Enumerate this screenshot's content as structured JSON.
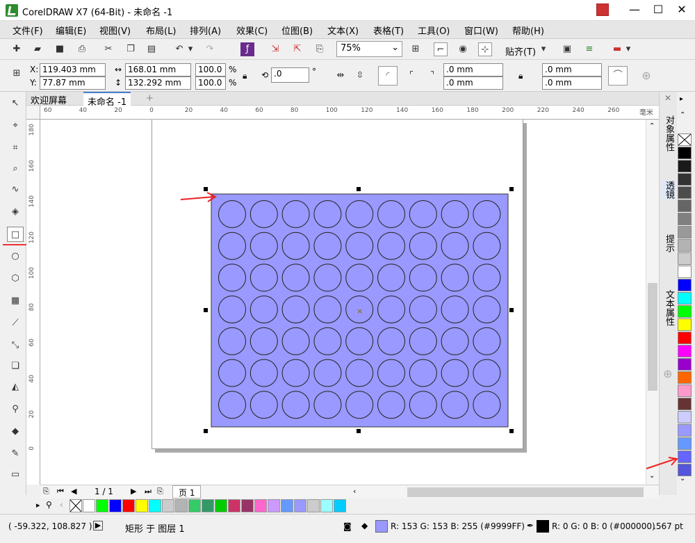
{
  "window": {
    "title": "CorelDRAW X7 (64-Bit) - 未命名 -1",
    "minimize": "—",
    "maximize": "☐",
    "close": "✕"
  },
  "menu": [
    "文件(F)",
    "编辑(E)",
    "视图(V)",
    "布局(L)",
    "排列(A)",
    "效果(C)",
    "位图(B)",
    "文本(X)",
    "表格(T)",
    "工具(O)",
    "窗口(W)",
    "帮助(H)"
  ],
  "toolbar": {
    "zoom": "75%",
    "snap": "贴齐(T)"
  },
  "propbar": {
    "x_label": "X:",
    "x": "119.403 mm",
    "y_label": "Y:",
    "y": "77.87 mm",
    "w": "168.01 mm",
    "h": "132.292 mm",
    "scale_w": "100.0",
    "scale_h": "100.0",
    "pct": "%",
    "angle": ".0",
    "deg": "°",
    "corner1": ".0 mm",
    "corner2": ".0 mm",
    "corner3": ".0 mm",
    "corner4": ".0 mm"
  },
  "tabs": {
    "welcome": "欢迎屏幕",
    "doc": "未命名 -1",
    "add": "+"
  },
  "ruler": {
    "unit": "毫米",
    "h_ticks": [
      "60",
      "40",
      "20",
      "0",
      "20",
      "40",
      "60",
      "80",
      "100",
      "120",
      "140",
      "160",
      "180",
      "200",
      "220",
      "240",
      "260"
    ],
    "v_ticks": [
      "180",
      "160",
      "140",
      "120",
      "100",
      "80",
      "60",
      "40",
      "20",
      "0"
    ]
  },
  "pagebar": {
    "page_count": "1 / 1",
    "page_tab": "页 1"
  },
  "dock": {
    "tab1": "对象属性",
    "tab2": "透镜",
    "tab3": "提示",
    "tab4": "文本属性"
  },
  "palette_h": [
    "#ffffff",
    "#00ff00",
    "#0000ff",
    "#ff0000",
    "#ffff00",
    "#00ffff",
    "#cccccc",
    "#b3b3b3",
    "#33cc66",
    "#339966",
    "#00cc00",
    "#cc3366",
    "#993366",
    "#ff66cc",
    "#cc99ff",
    "#6699ff",
    "#9999ff",
    "#cccccc",
    "#99ffff",
    "#00ccff"
  ],
  "palette_v": [
    "#000000",
    "#1a1a1a",
    "#333333",
    "#4d4d4d",
    "#666666",
    "#808080",
    "#999999",
    "#b3b3b3",
    "#cccccc",
    "#ffffff",
    "#0000ff",
    "#00ffff",
    "#00ff00",
    "#ffff00",
    "#ff0000",
    "#ff00ff",
    "#9900cc",
    "#ff6600",
    "#ff99cc",
    "#663333",
    "#ccccff",
    "#9999ff",
    "#6699ff",
    "#6666ff",
    "#5555dd"
  ],
  "colors": {
    "rect_fill": "#9999ff",
    "marker": "#ee2222"
  },
  "status": {
    "coords": "( -59.322, 108.827 )",
    "object": "矩形 于 图层 1",
    "fill": "R: 153 G: 153 B: 255 (#9999FF)",
    "outline": "R: 0 G: 0 B: 0 (#000000)",
    "outline_width": ".567 pt"
  },
  "grid": {
    "rows": 7,
    "cols": 9
  }
}
